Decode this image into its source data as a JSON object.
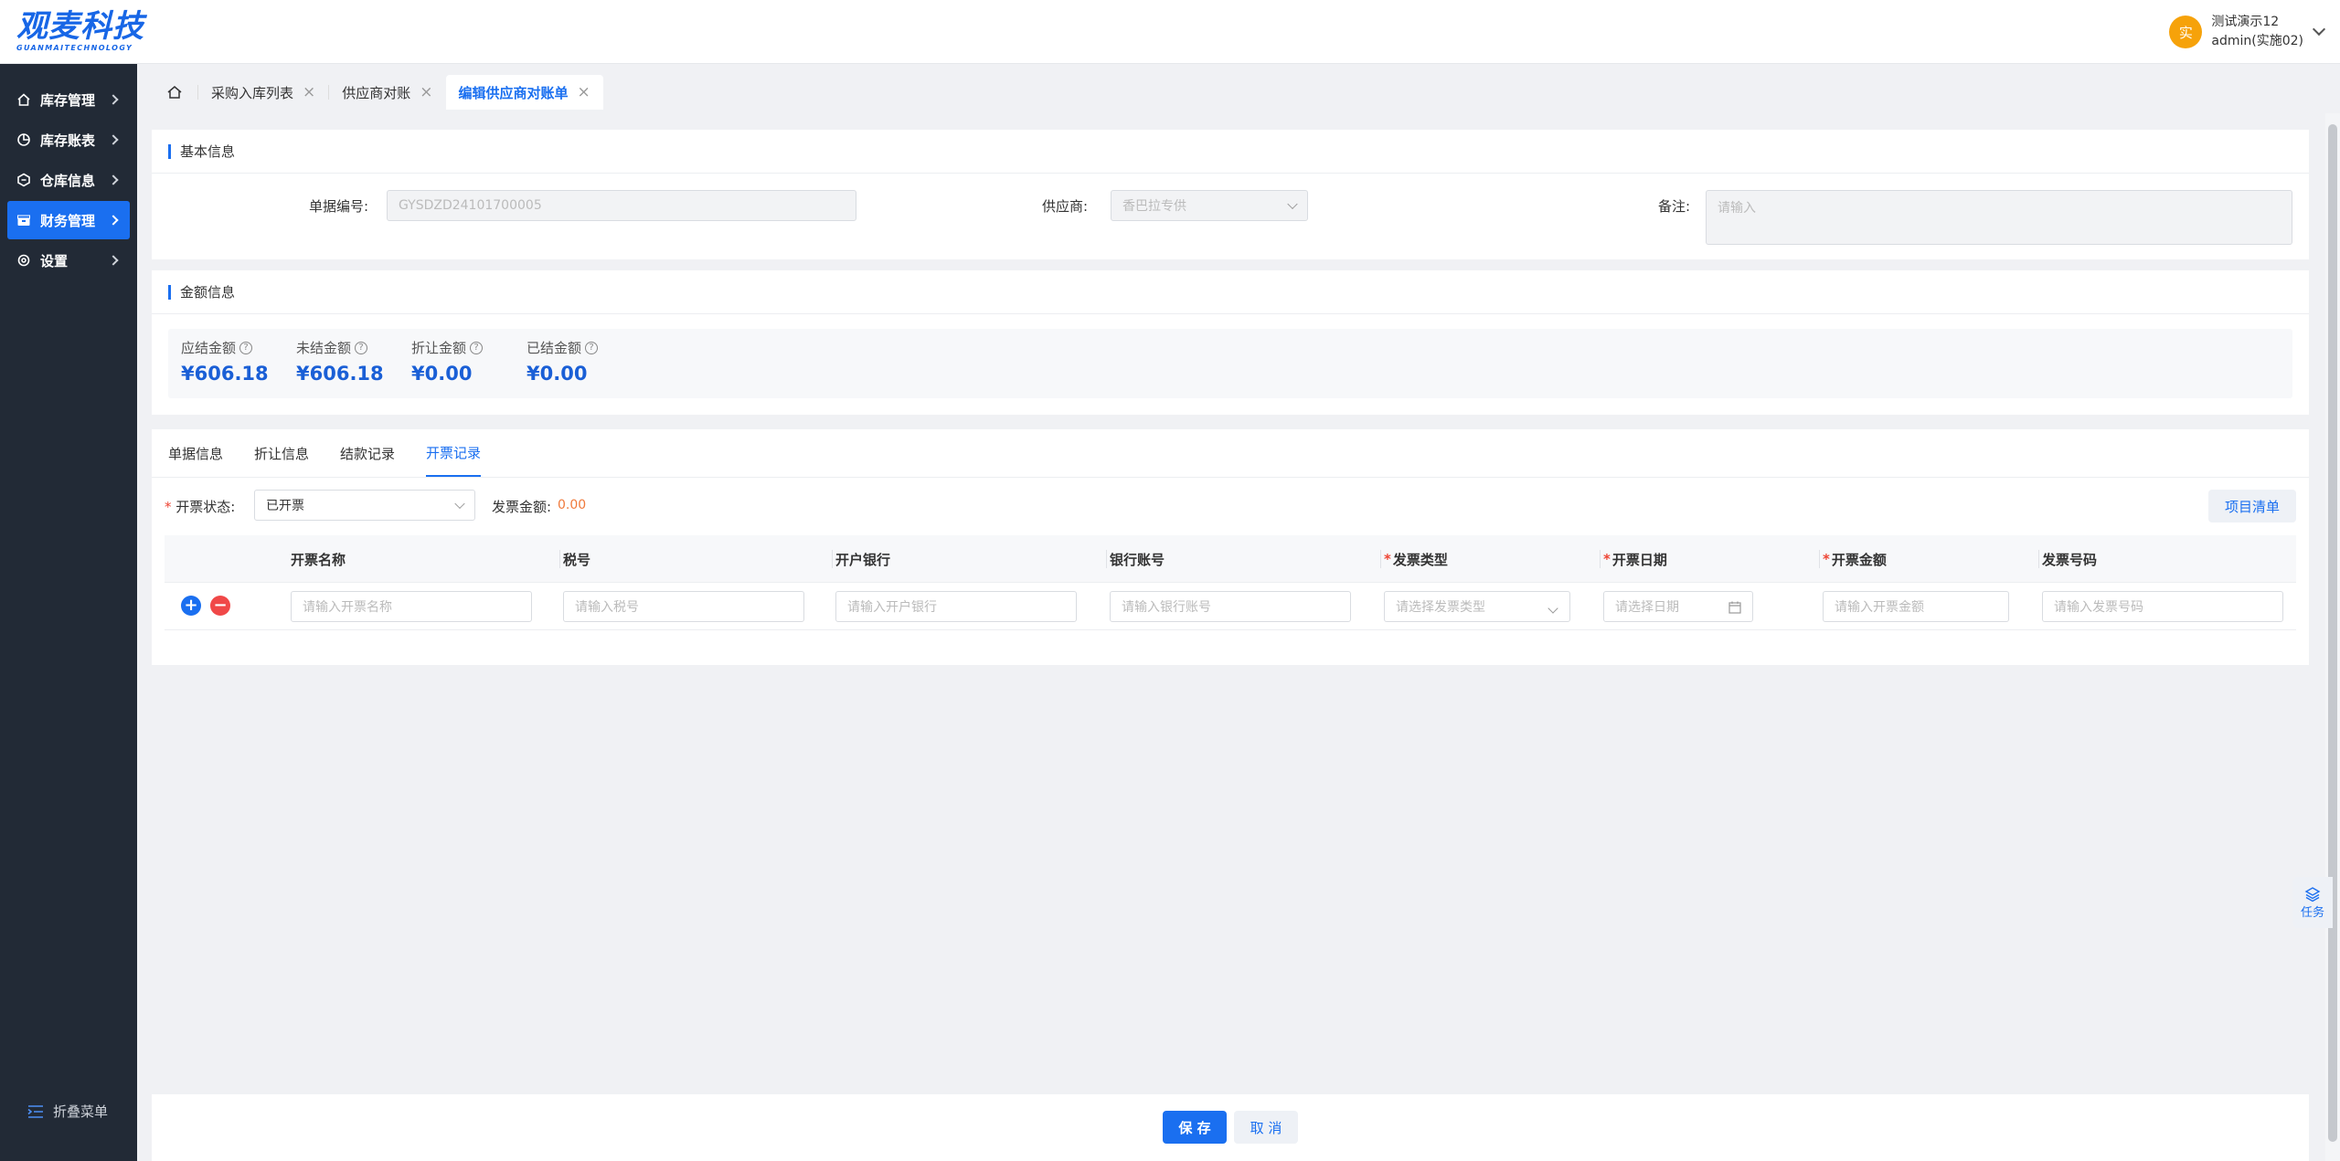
{
  "header": {
    "logo_text": "观麦科技",
    "logo_sub": "GUANMAITECHNOLOGY",
    "avatar_text": "实",
    "user_name": "测试演示12",
    "user_account": "admin(实施02)"
  },
  "sidebar": {
    "items": [
      {
        "label": "库存管理",
        "icon": "home-icon"
      },
      {
        "label": "库存账表",
        "icon": "pie-chart-icon"
      },
      {
        "label": "仓库信息",
        "icon": "warehouse-icon"
      },
      {
        "label": "财务管理",
        "icon": "wallet-icon",
        "active": true
      },
      {
        "label": "设置",
        "icon": "gear-icon"
      }
    ],
    "collapse_label": "折叠菜单"
  },
  "tabs": [
    {
      "label": "采购入库列表"
    },
    {
      "label": "供应商对账"
    },
    {
      "label": "编辑供应商对账单",
      "active": true
    }
  ],
  "basic_info": {
    "title": "基本信息",
    "doc_no_label": "单据编号:",
    "doc_no_value": "GYSDZD24101700005",
    "supplier_label": "供应商:",
    "supplier_value": "香巴拉专供",
    "remark_label": "备注:",
    "remark_placeholder": "请输入"
  },
  "amount_info": {
    "title": "金额信息",
    "items": [
      {
        "label": "应结金额",
        "value": "¥606.18"
      },
      {
        "label": "未结金额",
        "value": "¥606.18"
      },
      {
        "label": "折让金额",
        "value": "¥0.00"
      },
      {
        "label": "已结金额",
        "value": "¥0.00"
      }
    ]
  },
  "detail": {
    "subtabs": [
      "单据信息",
      "折让信息",
      "结款记录",
      "开票记录"
    ],
    "active_subtab": "开票记录",
    "invoice_status_label": "开票状态:",
    "invoice_status_value": "已开票",
    "invoice_amount_label": "发票金额:",
    "invoice_amount_value": "0.00",
    "project_list_button": "项目清单",
    "columns": [
      {
        "label": "开票名称",
        "required": false,
        "placeholder": "请输入开票名称"
      },
      {
        "label": "税号",
        "required": false,
        "placeholder": "请输入税号"
      },
      {
        "label": "开户银行",
        "required": false,
        "placeholder": "请输入开户银行"
      },
      {
        "label": "银行账号",
        "required": false,
        "placeholder": "请输入银行账号"
      },
      {
        "label": "发票类型",
        "required": true,
        "placeholder": "请选择发票类型"
      },
      {
        "label": "开票日期",
        "required": true,
        "placeholder": "请选择日期"
      },
      {
        "label": "开票金额",
        "required": true,
        "placeholder": "请输入开票金额"
      },
      {
        "label": "发票号码",
        "required": false,
        "placeholder": "请输入发票号码"
      }
    ]
  },
  "footer": {
    "save_label": "保 存",
    "cancel_label": "取 消"
  },
  "float_task_label": "任务",
  "colors": {
    "primary": "#1a6ff0",
    "sidebar_bg": "#222a36",
    "amount_blue": "#1a5fd6",
    "avatar_orange": "#f6a20a",
    "add_blue": "#1a6ff0",
    "remove_red": "#f04848"
  }
}
